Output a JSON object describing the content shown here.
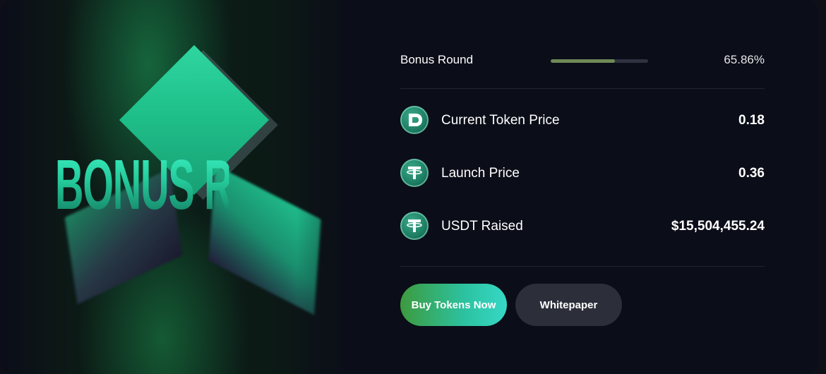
{
  "hero": {
    "title": "BONUS ROUND"
  },
  "progress": {
    "label": "Bonus Round",
    "percent_text": "65.86%",
    "fraction": 0.6586
  },
  "stats": [
    {
      "icon": "d-token-icon",
      "label": "Current Token Price",
      "value": "0.18"
    },
    {
      "icon": "tether-icon",
      "label": "Launch Price",
      "value": "0.36"
    },
    {
      "icon": "tether-icon",
      "label": "USDT Raised",
      "value": "$15,504,455.24"
    }
  ],
  "buttons": {
    "buy": "Buy Tokens Now",
    "whitepaper": "Whitepaper"
  },
  "colors": {
    "background": "#0b0d18",
    "accent_green": "#2cc2a0",
    "progress_fill": "#6f8a55",
    "secondary_button": "#2c2f3a"
  }
}
